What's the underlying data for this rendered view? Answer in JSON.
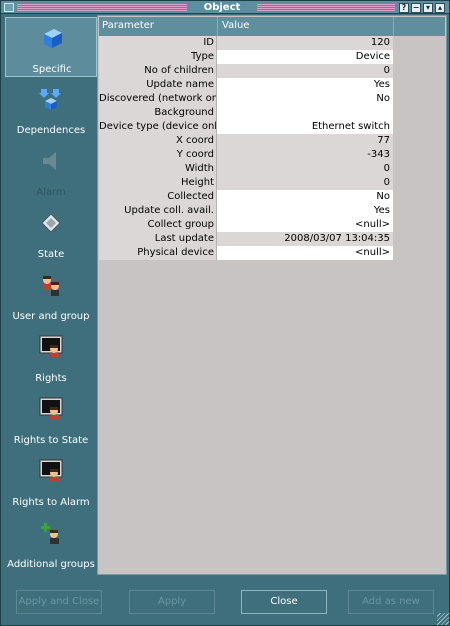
{
  "window": {
    "title": "Object"
  },
  "titlebar_buttons": {
    "help": "?",
    "minimize": "−",
    "maximize": "▾",
    "close": "▴"
  },
  "sidebar": {
    "items": [
      {
        "label": "Specific",
        "icon": "cube-icon",
        "active": true,
        "enabled": true
      },
      {
        "label": "Dependences",
        "icon": "dependences-icon",
        "active": false,
        "enabled": true
      },
      {
        "label": "Alarm",
        "icon": "alarm-icon",
        "active": false,
        "enabled": false
      },
      {
        "label": "State",
        "icon": "diamond-icon",
        "active": false,
        "enabled": true
      },
      {
        "label": "User and group",
        "icon": "users-icon",
        "active": false,
        "enabled": true
      },
      {
        "label": "Rights",
        "icon": "rights-monitor-icon",
        "active": false,
        "enabled": true
      },
      {
        "label": "Rights to State",
        "icon": "rights-state-monitor-icon",
        "active": false,
        "enabled": true
      },
      {
        "label": "Rights to Alarm",
        "icon": "rights-alarm-monitor-icon",
        "active": false,
        "enabled": true
      },
      {
        "label": "Additional groups",
        "icon": "add-group-icon",
        "active": false,
        "enabled": true
      }
    ]
  },
  "table": {
    "headers": {
      "parameter": "Parameter",
      "value": "Value"
    },
    "rows": [
      {
        "param": "ID",
        "value": "120",
        "editable": false
      },
      {
        "param": "Type",
        "value": "Device",
        "editable": true
      },
      {
        "param": "No of children",
        "value": "0",
        "editable": false
      },
      {
        "param": "Update name",
        "value": "Yes",
        "editable": true
      },
      {
        "param": "Discovered (network only)",
        "value": "No",
        "editable": true
      },
      {
        "param": "Background",
        "value": "",
        "editable": true
      },
      {
        "param": "Device type (device only)",
        "value": "Ethernet switch",
        "editable": true
      },
      {
        "param": "X coord",
        "value": "77",
        "editable": false
      },
      {
        "param": "Y coord",
        "value": "-343",
        "editable": false
      },
      {
        "param": "Width",
        "value": "0",
        "editable": false
      },
      {
        "param": "Height",
        "value": "0",
        "editable": false
      },
      {
        "param": "Collected",
        "value": "No",
        "editable": true
      },
      {
        "param": "Update coll. avail.",
        "value": "Yes",
        "editable": true
      },
      {
        "param": "Collect group",
        "value": "<null>",
        "editable": true
      },
      {
        "param": "Last update",
        "value": "2008/03/07 13:04:35",
        "editable": false
      },
      {
        "param": "Physical device",
        "value": "<null>",
        "editable": true
      }
    ]
  },
  "buttons": {
    "apply_close": "Apply and Close",
    "apply": "Apply",
    "close": "Close",
    "add_as_new": "Add as new"
  }
}
